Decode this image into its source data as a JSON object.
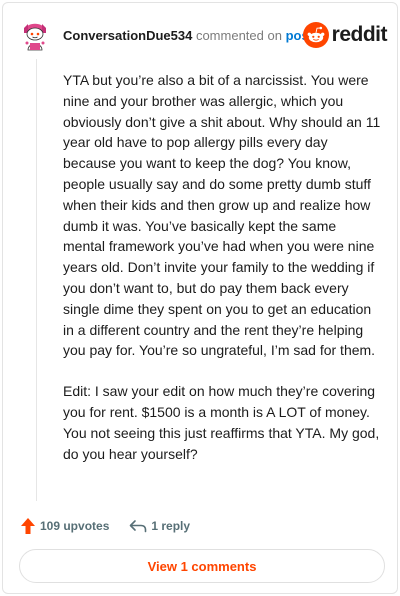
{
  "header": {
    "username": "ConversationDue534",
    "commented_text": "commented on",
    "post_link": "post",
    "brand": "reddit"
  },
  "comment": {
    "paragraphs": [
      "YTA but you’re also a bit of a narcissist. You were nine and your brother was allergic, which you obviously don’t give a shit about. Why should an 11 year old have to pop allergy pills every day because you want to keep the dog? You know, people usually say and do some pretty dumb stuff when their kids and then grow up and realize how dumb it was. You’ve basically kept the same mental framework you’ve had when you were nine years old. Don’t invite your family to the wedding if you don’t want to, but do pay them back every single dime they spent on you to get an education in a different country and the rent they’re helping you pay for. You’re so ungrateful, I’m sad for them.",
      "Edit: I saw your edit on how much they’re covering you for rent. $1500 is a month is A LOT of money. You not seeing this just reaffirms that YTA. My god, do you hear yourself?"
    ]
  },
  "actions": {
    "upvotes": "109 upvotes",
    "replies": "1 reply"
  },
  "view_comments_label": "View 1 comments",
  "colors": {
    "accent": "#ff4500",
    "link": "#0079d3",
    "muted": "#7c7c7c"
  },
  "icons": [
    "avatar-snoo-icon",
    "reddit-logo-icon",
    "upvote-arrow-icon",
    "reply-arrow-icon"
  ]
}
